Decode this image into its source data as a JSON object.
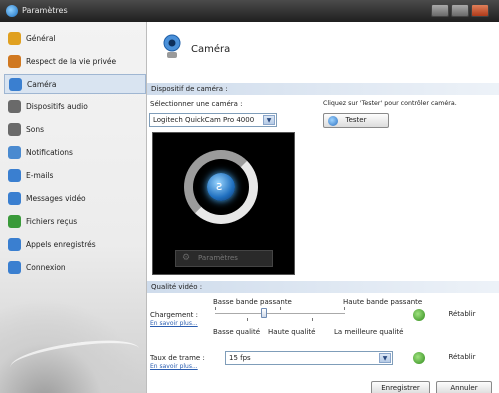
{
  "window": {
    "title": "Paramètres"
  },
  "sidebar": {
    "items": [
      {
        "label": "Général",
        "icon": "general-icon",
        "color": "#e0a020"
      },
      {
        "label": "Respect de la vie privée",
        "icon": "privacy-icon",
        "color": "#d07820"
      },
      {
        "label": "Caméra",
        "icon": "camera-icon",
        "color": "#3a7fd0",
        "selected": true
      },
      {
        "label": "Dispositifs audio",
        "icon": "audio-devices-icon",
        "color": "#6a6a6a"
      },
      {
        "label": "Sons",
        "icon": "sounds-icon",
        "color": "#6a6a6a"
      },
      {
        "label": "Notifications",
        "icon": "notifications-icon",
        "color": "#4a8ad0"
      },
      {
        "label": "E-mails",
        "icon": "email-icon",
        "color": "#3a7fd0"
      },
      {
        "label": "Messages vidéo",
        "icon": "video-message-icon",
        "color": "#3a7fd0"
      },
      {
        "label": "Fichiers reçus",
        "icon": "received-files-icon",
        "color": "#3a9a3a"
      },
      {
        "label": "Appels enregistrés",
        "icon": "recorded-calls-icon",
        "color": "#3a7fd0"
      },
      {
        "label": "Connexion",
        "icon": "connection-icon",
        "color": "#3a7fd0"
      }
    ]
  },
  "main": {
    "title": "Caméra",
    "device_section": {
      "header": "Dispositif de caméra :",
      "select_label": "Sélectionner une caméra :",
      "selected_camera": "Logitech QuickCam Pro 4000",
      "test_hint": "Cliquez sur 'Tester' pour contrôler caméra.",
      "test_button": "Tester",
      "params_button": "Paramètres"
    },
    "quality_section": {
      "header": "Qualité vidéo :",
      "load_label": "Chargement :",
      "learn_more": "En savoir plus...",
      "low_bandwidth": "Basse bande passante",
      "high_bandwidth": "Haute bande passante",
      "low_quality": "Basse qualité",
      "high_quality": "Haute qualité",
      "best_quality": "La meilleure qualité",
      "reset_button": "Rétablir",
      "slider_value": 0.38,
      "framerate_label": "Taux de trame :",
      "framerate_value": "15 fps",
      "framerate_reset": "Rétablir"
    },
    "footer": {
      "save_button": "Enregistrer",
      "cancel_button": "Annuler"
    }
  }
}
